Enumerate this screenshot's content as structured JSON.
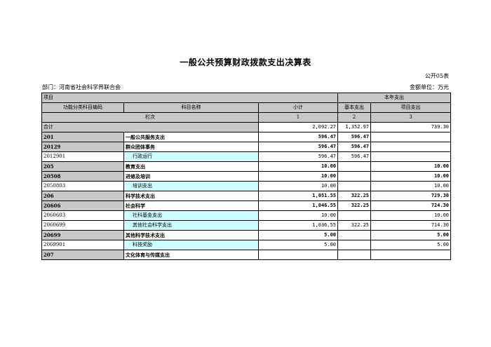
{
  "title": "一般公共预算财政拨款支出决算表",
  "form_no": "公开05表",
  "department": "部门：河南省社会科学界联合会",
  "unit": "金额单位：万元",
  "header": {
    "item": "项目",
    "current_year": "本年支出",
    "func_code": "功能分类科目编码",
    "subject_name": "科目名称",
    "subtotal": "小计",
    "basic": "基本支出",
    "project": "项目支出",
    "column_index": "栏次",
    "col1": "1",
    "col2": "2",
    "col3": "3"
  },
  "total": {
    "label": "合计",
    "subtotal": "2,092.27",
    "basic": "1,352.97",
    "project": "739.30"
  },
  "rows": [
    {
      "code": "201",
      "name": "一般公共服务支出",
      "subtotal": "596.47",
      "basic": "596.47",
      "project": "",
      "level": 1
    },
    {
      "code": "20129",
      "name": "群众团体事务",
      "subtotal": "596.47",
      "basic": "596.47",
      "project": "",
      "level": 2
    },
    {
      "code": "2012901",
      "name": "行政运行",
      "subtotal": "596.47",
      "basic": "596.47",
      "project": "",
      "level": 3
    },
    {
      "code": "205",
      "name": "教育支出",
      "subtotal": "10.00",
      "basic": "",
      "project": "10.00",
      "level": 1
    },
    {
      "code": "20508",
      "name": "进修及培训",
      "subtotal": "10.00",
      "basic": "",
      "project": "10.00",
      "level": 2
    },
    {
      "code": "2050803",
      "name": "培训支出",
      "subtotal": "10.00",
      "basic": "",
      "project": "10.00",
      "level": 3
    },
    {
      "code": "206",
      "name": "科学技术支出",
      "subtotal": "1,051.55",
      "basic": "322.25",
      "project": "729.30",
      "level": 1
    },
    {
      "code": "20606",
      "name": "社会科学",
      "subtotal": "1,046.55",
      "basic": "322.25",
      "project": "724.30",
      "level": 2
    },
    {
      "code": "2060603",
      "name": "社科基金支出",
      "subtotal": "10.00",
      "basic": "",
      "project": "10.00",
      "level": 3
    },
    {
      "code": "2060699",
      "name": "其他社会科学支出",
      "subtotal": "1,036.55",
      "basic": "322.25",
      "project": "714.30",
      "level": 3
    },
    {
      "code": "20699",
      "name": "其他科学技术支出",
      "subtotal": "5.00",
      "basic": "",
      "project": "5.00",
      "level": 2
    },
    {
      "code": "2069901",
      "name": "科技奖励",
      "subtotal": "5.00",
      "basic": "",
      "project": "5.00",
      "level": 3
    },
    {
      "code": "207",
      "name": "文化体育与传媒支出",
      "subtotal": "",
      "basic": "",
      "project": "",
      "level": 1
    }
  ]
}
